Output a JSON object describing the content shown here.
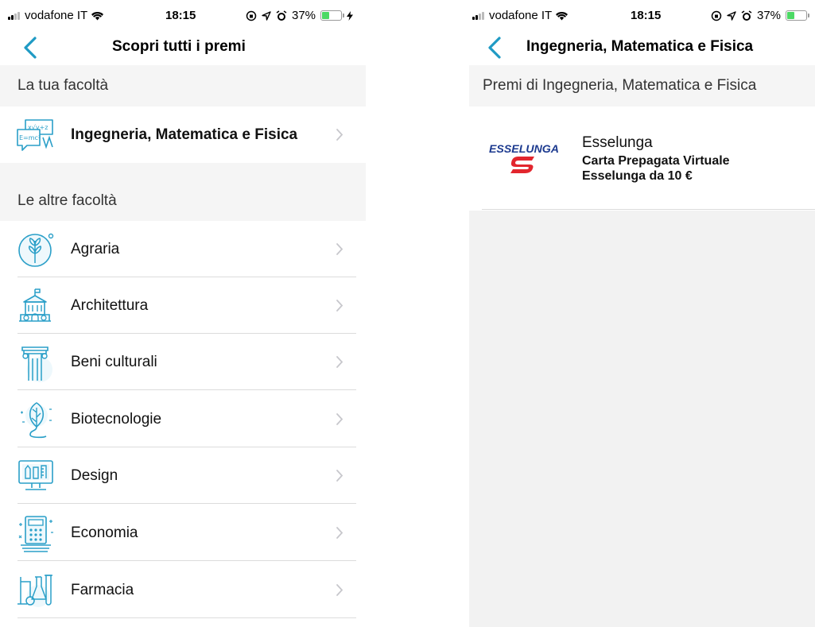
{
  "status_bar": {
    "carrier": "vodafone IT",
    "time": "18:15",
    "battery_percent": "37%",
    "battery_level": 0.37
  },
  "left_screen": {
    "nav_title": "Scopri tutti i premi",
    "my_faculty_header": "La tua facoltà",
    "my_faculty": {
      "label": "Ingegneria, Matematica e Fisica",
      "icon": "formula-icon"
    },
    "other_faculties_header": "Le altre facoltà",
    "faculties": [
      {
        "label": "Agraria",
        "icon": "wheat-icon"
      },
      {
        "label": "Architettura",
        "icon": "building-icon"
      },
      {
        "label": "Beni culturali",
        "icon": "column-icon"
      },
      {
        "label": "Biotecnologie",
        "icon": "leaf-dna-icon"
      },
      {
        "label": "Design",
        "icon": "design-monitor-icon"
      },
      {
        "label": "Economia",
        "icon": "calculator-icon"
      },
      {
        "label": "Farmacia",
        "icon": "flask-icon"
      }
    ]
  },
  "right_screen": {
    "nav_title": "Ingegneria, Matematica e Fisica",
    "section_header": "Premi di Ingegneria, Matematica e Fisica",
    "prizes": [
      {
        "brand": "Esselunga",
        "logo_text": "ESSELUNGA",
        "title_line1": "Carta Prepagata Virtuale",
        "title_line2": "Esselunga da 10 €"
      }
    ]
  },
  "colors": {
    "accent": "#1f9ac4",
    "icon": "#2a9fc8",
    "section_bg": "#f5f5f5",
    "esselunga_blue": "#1c3a8f",
    "esselunga_red": "#e2262e",
    "battery": "#4cd964"
  }
}
